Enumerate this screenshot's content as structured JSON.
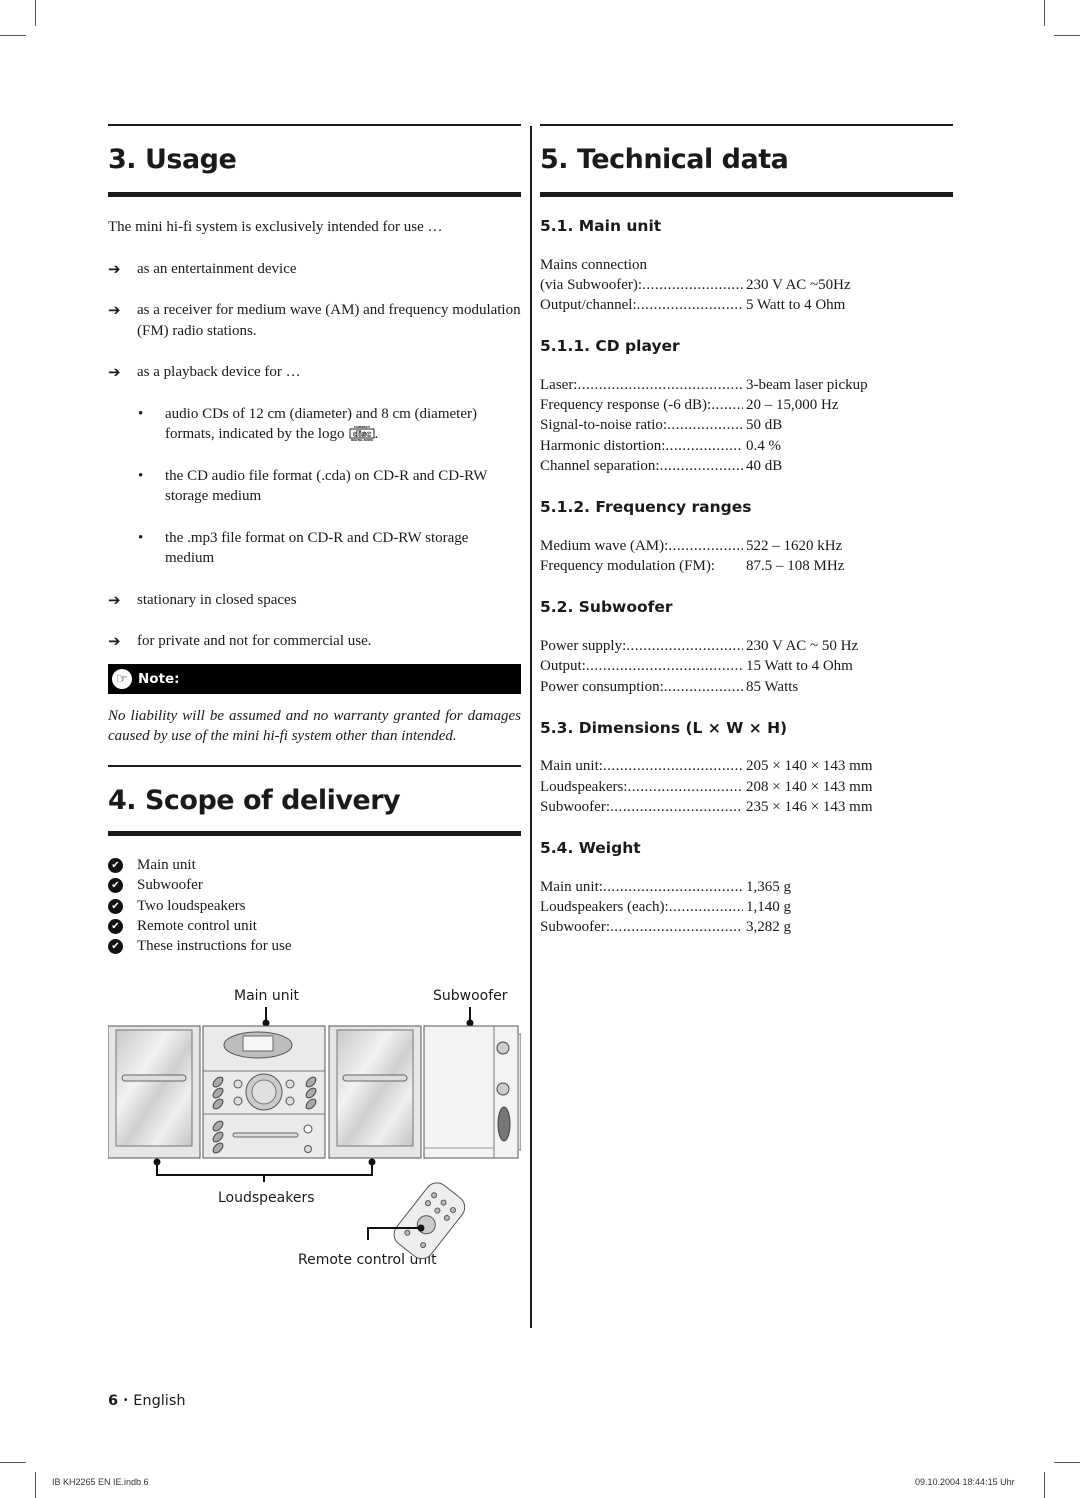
{
  "usage": {
    "heading": "3. Usage",
    "intro": "The mini hi-fi system is exclusively intended for use …",
    "items": [
      {
        "type": "arrow",
        "text": "as an entertainment device"
      },
      {
        "type": "arrow",
        "text": "as a receiver for medium wave (AM) and frequency modulation (FM) radio stations."
      },
      {
        "type": "arrow",
        "text": "as a playback device for …"
      },
      {
        "type": "bullet",
        "text": "audio CDs of 12 cm (diameter) and 8 cm (diameter) formats, indicated by the logo",
        "has_logo": true,
        "logo_icon": "compact-disc-digital-audio-logo"
      },
      {
        "type": "bullet",
        "text": "the CD audio file format (.cda) on CD-R and CD-RW storage medium"
      },
      {
        "type": "bullet",
        "text": "the .mp3 file format on CD-R and CD-RW storage medium"
      },
      {
        "type": "arrow",
        "text": "stationary in closed spaces"
      },
      {
        "type": "arrow",
        "text": "for private and not for commercial use."
      }
    ],
    "note": {
      "icon": "pointing-hand-icon",
      "label": "Note:",
      "text": "No liability will be assumed and no warranty granted for damages caused by use of the mini hi-fi system other than intended."
    }
  },
  "scope": {
    "heading": "4. Scope of delivery",
    "items": [
      "Main unit",
      "Subwoofer",
      "Two loudspeakers",
      "Remote control unit",
      "These instructions for use"
    ],
    "figure_labels": {
      "main_unit": "Main unit",
      "subwoofer": "Subwoofer",
      "loudspeakers": "Loudspeakers",
      "remote": "Remote control unit"
    }
  },
  "technical": {
    "heading": "5. Technical data",
    "sections": [
      {
        "title": "5.1. Main unit",
        "pre": "Mains connection",
        "rows": [
          {
            "label": "(via Subwoofer):",
            "value": "230 V AC ~50Hz"
          },
          {
            "label": "Output/channel:",
            "value": "5 Watt to 4 Ohm"
          }
        ]
      },
      {
        "title": "5.1.1. CD player",
        "rows": [
          {
            "label": "Laser:",
            "value": "3-beam laser pickup"
          },
          {
            "label": "Frequency response  (-6 dB):",
            "value": "20 – 15,000 Hz"
          },
          {
            "label": "Signal-to-noise ratio:",
            "value": "50 dB"
          },
          {
            "label": "Harmonic distortion:",
            "value": "0.4 %"
          },
          {
            "label": "Channel separation:",
            "value": "40 dB"
          }
        ]
      },
      {
        "title": "5.1.2. Frequency ranges",
        "rows": [
          {
            "label": "Medium wave (AM):",
            "value": "522 – 1620 kHz"
          },
          {
            "label": "Frequency modulation (FM):",
            "value": "87.5 – 108 MHz",
            "nodots": true
          }
        ]
      },
      {
        "title": "5.2. Subwoofer",
        "rows": [
          {
            "label": "Power supply:",
            "value": "230 V AC ~ 50 Hz"
          },
          {
            "label": "Output:",
            "value": "15 Watt to 4 Ohm"
          },
          {
            "label": "Power consumption:",
            "value": "85 Watts"
          }
        ]
      },
      {
        "title": "5.3. Dimensions (L × W × H)",
        "rows": [
          {
            "label": "Main unit:",
            "value": "205 × 140 × 143 mm"
          },
          {
            "label": "Loudspeakers:",
            "value": "208 × 140 × 143 mm"
          },
          {
            "label": "Subwoofer:",
            "value": "235 × 146 × 143 mm"
          }
        ]
      },
      {
        "title": "5.4. Weight",
        "rows": [
          {
            "label": "Main unit:",
            "value": "1,365 g"
          },
          {
            "label": "Loudspeakers (each):",
            "value": "1,140 g"
          },
          {
            "label": "Subwoofer:",
            "value": "3,282 g"
          }
        ]
      }
    ]
  },
  "footer": {
    "page_number": "6",
    "separator": "•",
    "language": "English",
    "slug_file": "IB KH2265 EN IE.indb   6",
    "slug_date": "09.10.2004   18:44:15 Uhr"
  }
}
